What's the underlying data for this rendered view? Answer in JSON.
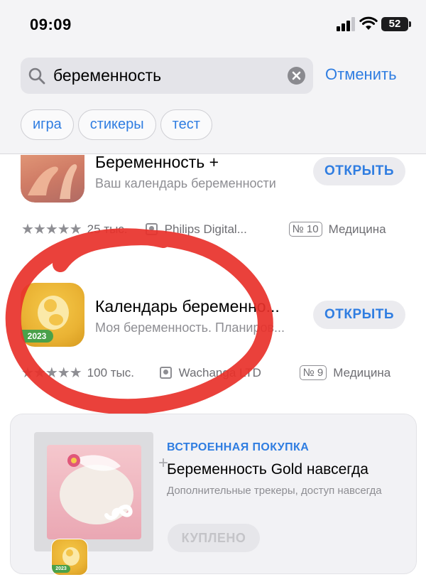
{
  "status_bar": {
    "time": "09:09",
    "battery": "52"
  },
  "search": {
    "query": "беременность",
    "cancel_label": "Отменить"
  },
  "suggestions": [
    "игра",
    "стикеры",
    "тест"
  ],
  "apps": [
    {
      "title": "Беременность +",
      "subtitle": "Ваш календарь беременности",
      "button": "ОТКРЫТЬ",
      "stars": "★★★★★",
      "ratings": "25 тыс.",
      "developer": "Philips Digital...",
      "rank": "№ 10",
      "category": "Медицина"
    },
    {
      "title": "Календарь беременно...",
      "subtitle": "Моя беременность. Планиров...",
      "button": "ОТКРЫТЬ",
      "stars": "★★★★★",
      "ratings": "100 тыс.",
      "developer": "Wachanga LTD",
      "rank": "№ 9",
      "category": "Медицина",
      "icon_badge": "2023"
    }
  ],
  "iap": {
    "badge": "ВСТРОЕННАЯ ПОКУПКА",
    "title": "Беременность Gold навсегда",
    "description": "Дополнительные трекеры, доступ навсегда",
    "button": "КУПЛЕНО",
    "icon_badge": "2023"
  },
  "colors": {
    "accent": "#2f7de1",
    "annotation": "#e8312a"
  }
}
